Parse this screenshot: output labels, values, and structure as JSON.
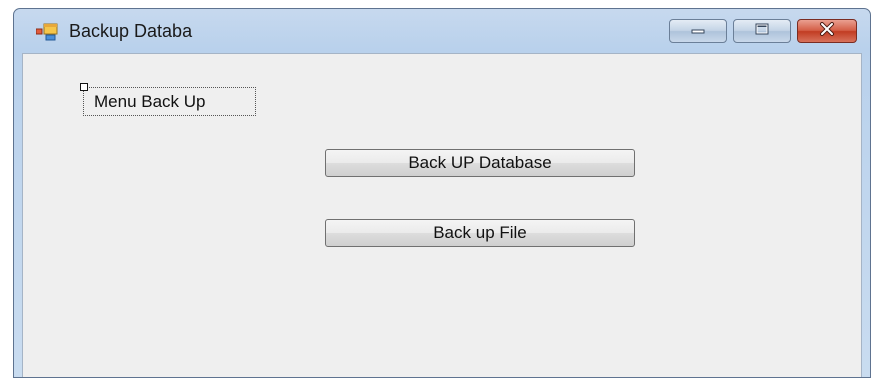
{
  "window": {
    "title": "Backup Databa",
    "controls": {
      "minimize": "minimize-icon",
      "maximize": "maximize-icon",
      "close": "close-icon"
    }
  },
  "menu": {
    "label": "Menu Back Up"
  },
  "buttons": {
    "backup_database": "Back UP Database",
    "backup_file": "Back up File"
  },
  "colors": {
    "client_bg": "#efefef",
    "frame": "#b9d1ec",
    "close": "#c13c22"
  }
}
